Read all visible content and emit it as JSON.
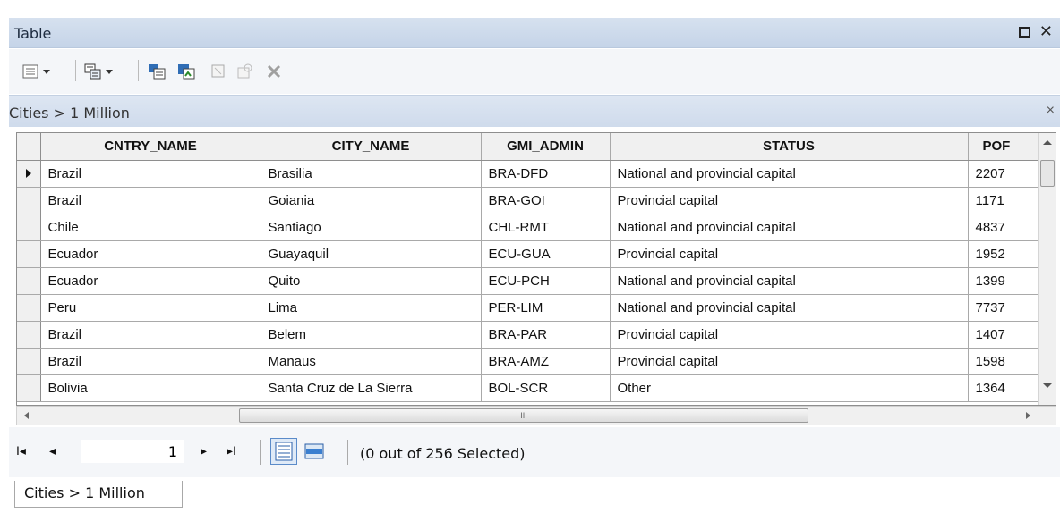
{
  "window": {
    "title": "Table",
    "maximize_icon": "maximize-icon",
    "close_glyph": "✕"
  },
  "toolbar": {
    "icons": [
      "table-options-icon",
      "related-tables-icon",
      "select-by-attributes-icon",
      "switch-selection-icon",
      "clear-selection-icon",
      "zoom-to-selected-icon",
      "delete-selected-icon"
    ]
  },
  "table_view": {
    "name": "Cities > 1 Million",
    "close_glyph": "×"
  },
  "grid": {
    "columns": [
      "CNTRY_NAME",
      "CITY_NAME",
      "GMI_ADMIN",
      "STATUS",
      "POF"
    ],
    "rows": [
      [
        "Brazil",
        "Brasilia",
        "BRA-DFD",
        "National and provincial capital",
        "2207"
      ],
      [
        "Brazil",
        "Goiania",
        "BRA-GOI",
        "Provincial capital",
        "1171"
      ],
      [
        "Chile",
        "Santiago",
        "CHL-RMT",
        "National and provincial capital",
        "4837"
      ],
      [
        "Ecuador",
        "Guayaquil",
        "ECU-GUA",
        "Provincial capital",
        "1952"
      ],
      [
        "Ecuador",
        "Quito",
        "ECU-PCH",
        "National and provincial capital",
        "1399"
      ],
      [
        "Peru",
        "Lima",
        "PER-LIM",
        "National and provincial capital",
        "7737"
      ],
      [
        "Brazil",
        "Belem",
        "BRA-PAR",
        "Provincial capital",
        "1407"
      ],
      [
        "Brazil",
        "Manaus",
        "BRA-AMZ",
        "Provincial capital",
        "1598"
      ],
      [
        "Bolivia",
        "Santa Cruz de La Sierra",
        "BOL-SCR",
        "Other",
        "1364"
      ]
    ],
    "current_row": 0
  },
  "hscroll": {
    "thumb_grip": "III"
  },
  "navigation": {
    "first_glyph": "I◂",
    "prev_glyph": "◂",
    "page": "1",
    "next_glyph": "▸",
    "last_glyph": "▸I",
    "selection_status": "(0 out of 256 Selected)"
  },
  "tabs": [
    {
      "label": "Cities > 1 Million"
    }
  ],
  "colors": {
    "title_bar": "#c5d4e8",
    "selection_accent": "#5b8bc9"
  }
}
